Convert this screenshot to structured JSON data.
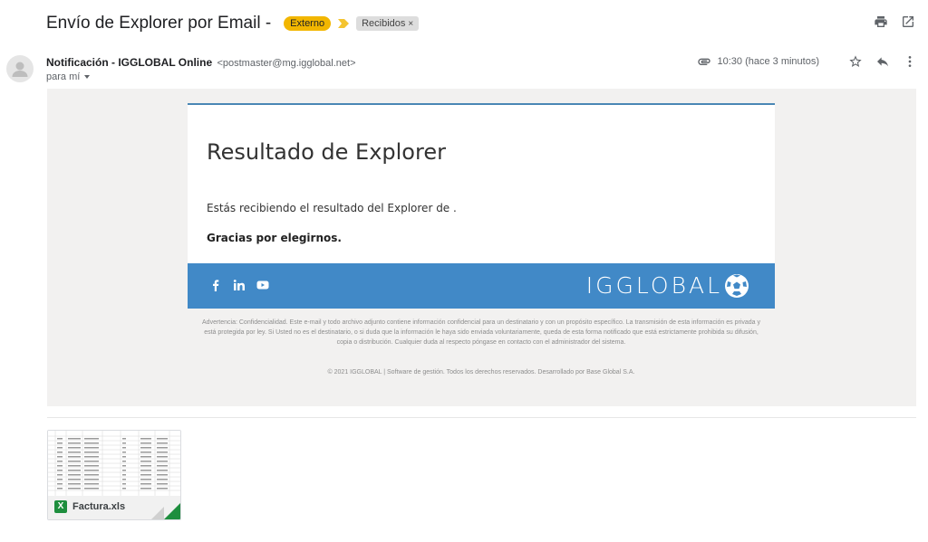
{
  "header": {
    "subject": "Envío de Explorer por Email -",
    "labels": [
      {
        "text": "Externo",
        "color": "#f2b600"
      },
      {
        "text": "Recibidos"
      }
    ],
    "remove_label_glyph": "×"
  },
  "message": {
    "sender_name": "Notificación - IGGLOBAL Online",
    "sender_email": "<postmaster@mg.igglobal.net>",
    "recipient_line": "para mí",
    "time": "10:30 (hace 3 minutos)"
  },
  "email": {
    "heading": "Resultado de Explorer",
    "body_line": "Estás recibiendo el resultado del Explorer de .",
    "thanks": "Gracias por elegirnos.",
    "brand": "IGGLOBAL",
    "social_icons": [
      "facebook-icon",
      "linkedin-icon",
      "youtube-icon"
    ],
    "disclaimer": "Advertencia: Confidencialidad. Este e-mail y todo archivo adjunto contiene información confidencial para un destinatario y con un propósito específico. La transmisión de esta información es privada y está protegida por ley. Si Usted no es el destinatario, o si duda que la información le haya sido enviada voluntariamente, queda de esta forma notificado que está estrictamente prohibida su difusión, copia o distribución. Cualquier duda al respecto póngase en contacto con el administrador del sistema.",
    "copyright": "© 2021 IGGLOBAL | Software de gestión. Todos los derechos reservados. Desarrollado por Base Global S.A.",
    "footer_color": "#4189c7"
  },
  "attachment": {
    "filename": "Factura.xls",
    "type_letter": "X"
  }
}
